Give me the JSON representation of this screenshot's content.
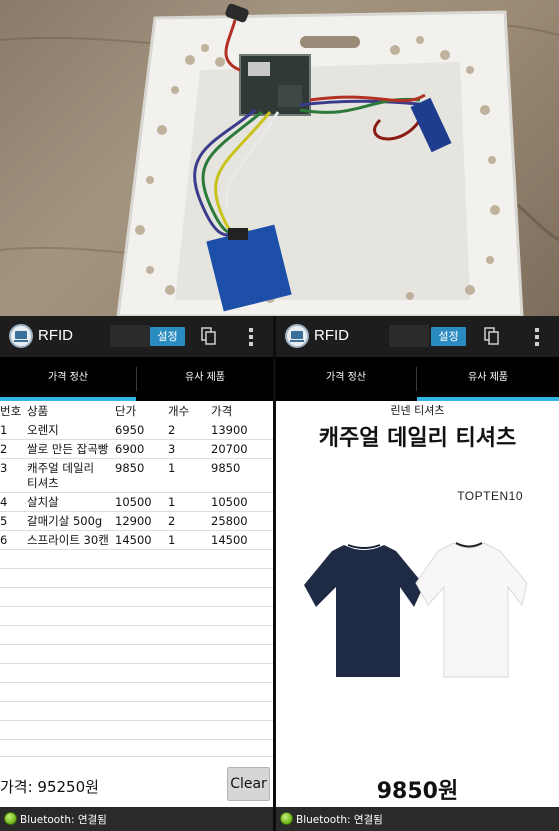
{
  "photo": {
    "scene": "Arduino RFID reader, Bluetooth module and wires in a white plastic basket"
  },
  "app": {
    "title": "RFID",
    "settings_label": "설정",
    "icons": [
      "app-monitor-icon",
      "copy-icon",
      "overflow-menu-icon"
    ]
  },
  "tabs": [
    {
      "label": "가격 정산"
    },
    {
      "label": "유사 제품"
    }
  ],
  "left_pane": {
    "columns": [
      "번호",
      "상품",
      "단가",
      "개수",
      "가격"
    ],
    "rows": [
      {
        "no": "1",
        "name": "오렌지",
        "unit": "6950",
        "qty": "2",
        "price": "13900"
      },
      {
        "no": "2",
        "name": "쌀로 만든 잡곡빵",
        "unit": "6900",
        "qty": "3",
        "price": "20700"
      },
      {
        "no": "3",
        "name": "캐주얼 데일리\n티셔츠",
        "unit": "9850",
        "qty": "1",
        "price": "9850"
      },
      {
        "no": "4",
        "name": "살치살",
        "unit": "10500",
        "qty": "1",
        "price": "10500"
      },
      {
        "no": "5",
        "name": "갈매기살 500g",
        "unit": "12900",
        "qty": "2",
        "price": "25800"
      },
      {
        "no": "6",
        "name": "스프라이트 30캔",
        "unit": "14500",
        "qty": "1",
        "price": "14500"
      }
    ],
    "total_label": "가격: 95250원",
    "clear_label": "Clear",
    "status": "Bluetooth: 연결됨"
  },
  "right_pane": {
    "subtitle": "린넨 티셔츠",
    "title": "캐주얼 데일리 티셔츠",
    "brand": "TOPTEN10",
    "price": "9850원",
    "status": "Bluetooth: 연결됨"
  },
  "colors": {
    "actionbar": "#1d1d1d",
    "accent": "#33b5e5",
    "settings_button": "#2a8bc0",
    "status_dot": "#6db516"
  }
}
